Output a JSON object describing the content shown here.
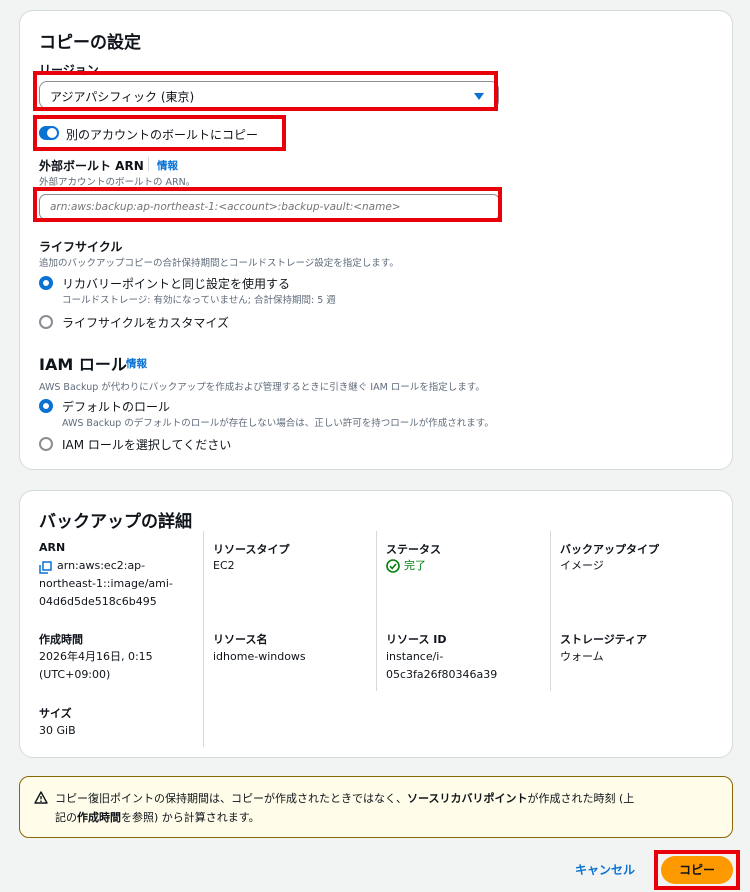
{
  "copy_settings": {
    "title": "コピーの設定",
    "region": {
      "label": "リージョン",
      "value": "アジアパシフィック (東京)"
    },
    "toggle_label": "別のアカウントのボールトにコピー",
    "external_vault": {
      "label": "外部ボールト ARN",
      "info": "情報",
      "description": "外部アカウントのボールトの ARN。",
      "placeholder": "arn:aws:backup:ap-northeast-1:<account>:backup-vault:<name>"
    },
    "lifecycle": {
      "label": "ライフサイクル",
      "description": "追加のバックアップコピーの合計保持期間とコールドストレージ設定を指定します。",
      "option1": "リカバリーポイントと同じ設定を使用する",
      "option1_sub": "コールドストレージ: 有効になっていません; 合計保持期間: 5 週",
      "option2": "ライフサイクルをカスタマイズ"
    },
    "iam": {
      "label": "IAM ロール",
      "info": "情報",
      "description": "AWS Backup が代わりにバックアップを作成および管理するときに引き継ぐ IAM ロールを指定します。",
      "option1": "デフォルトのロール",
      "option1_sub": "AWS Backup のデフォルトのロールが存在しない場合は、正しい許可を持つロールが作成されます。",
      "option2": "IAM ロールを選択してください"
    }
  },
  "backup_details": {
    "title": "バックアップの詳細",
    "arn": {
      "label": "ARN",
      "value_line1": "arn:aws:ec2:ap-",
      "value_line2": "northeast-1::image/ami-",
      "value_line3": "04d6d5de518c6b495"
    },
    "resource_type": {
      "label": "リソースタイプ",
      "value": "EC2"
    },
    "status": {
      "label": "ステータス",
      "value": "完了"
    },
    "backup_type": {
      "label": "バックアップタイプ",
      "value": "イメージ"
    },
    "created": {
      "label": "作成時間",
      "value_line1": "2026年4月16日, 0:15",
      "value_line2": "(UTC+09:00)"
    },
    "resource_name": {
      "label": "リソース名",
      "value": "idhome-windows"
    },
    "resource_id": {
      "label": "リソース ID",
      "value_line1": "instance/i-",
      "value_line2": "05c3fa26f80346a39"
    },
    "storage_tier": {
      "label": "ストレージティア",
      "value": "ウォーム"
    },
    "size": {
      "label": "サイズ",
      "value": "30 GiB"
    }
  },
  "alert": {
    "part1": "コピー復旧ポイントの保持期間は、コピーが作成されたときではなく、",
    "bold1": "ソースリカバリポイント",
    "part2": "が作成された時刻 (上",
    "part3": "記の",
    "bold2": "作成時間",
    "part4": "を参照) から計算されます。"
  },
  "footer": {
    "cancel": "キャンセル",
    "copy": "コピー"
  },
  "colors": {
    "accent": "#0972d3",
    "primary_button": "#ff9900",
    "success": "#037f0c",
    "highlight": "#e8000b",
    "warning_bg": "#fffce9"
  }
}
